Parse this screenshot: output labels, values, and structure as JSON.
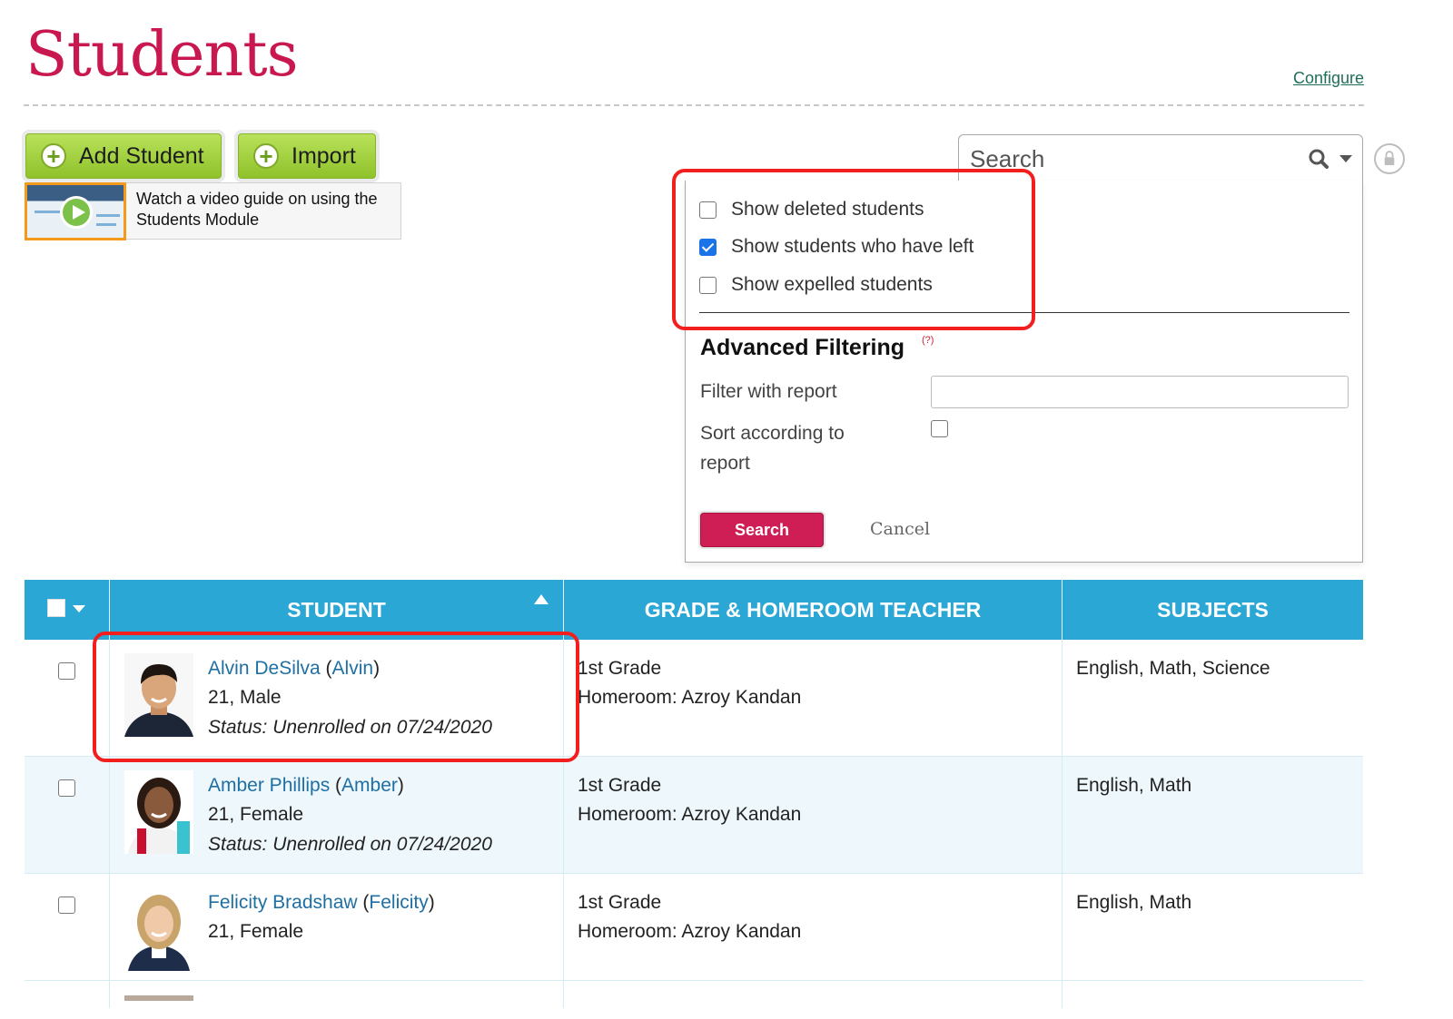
{
  "header": {
    "title": "Students",
    "configure_label": "Configure"
  },
  "toolbar": {
    "add_student_label": "Add Student",
    "import_label": "Import",
    "video_guide_text": "Watch a video guide on using the Students Module"
  },
  "search": {
    "placeholder": "Search"
  },
  "filters": {
    "options": [
      {
        "label": "Show deleted students",
        "checked": false
      },
      {
        "label": "Show students who have left",
        "checked": true
      },
      {
        "label": "Show expelled students",
        "checked": false
      }
    ],
    "advanced_title": "Advanced Filtering",
    "help_marker": "(?)",
    "filter_with_report_label": "Filter with report",
    "filter_with_report_value": "",
    "sort_according_label": "Sort according to report",
    "sort_according_checked": false,
    "search_button": "Search",
    "cancel_link": "Cancel"
  },
  "table": {
    "columns": [
      "STUDENT",
      "GRADE & HOMEROOM TEACHER",
      "SUBJECTS"
    ],
    "rows": [
      {
        "name": "Alvin DeSilva",
        "nickname": "Alvin",
        "age_gender": "21, Male",
        "status": "Status: Unenrolled on 07/24/2020",
        "grade": "1st Grade",
        "homeroom": "Homeroom: Azroy Kandan",
        "subjects": "English, Math, Science"
      },
      {
        "name": "Amber Phillips",
        "nickname": "Amber",
        "age_gender": "21, Female",
        "status": "Status: Unenrolled on 07/24/2020",
        "grade": "1st Grade",
        "homeroom": "Homeroom: Azroy Kandan",
        "subjects": "English, Math"
      },
      {
        "name": "Felicity Bradshaw",
        "nickname": "Felicity",
        "age_gender": "21, Female",
        "status": "",
        "grade": "1st Grade",
        "homeroom": "Homeroom: Azroy Kandan",
        "subjects": "English, Math"
      }
    ]
  },
  "colors": {
    "title": "#c8184f",
    "table_header": "#2aa7d5",
    "primary_button": "#cf1d55",
    "green_button": "#9bcc35",
    "highlight": "#f21f1f",
    "link": "#1f6fa3"
  }
}
